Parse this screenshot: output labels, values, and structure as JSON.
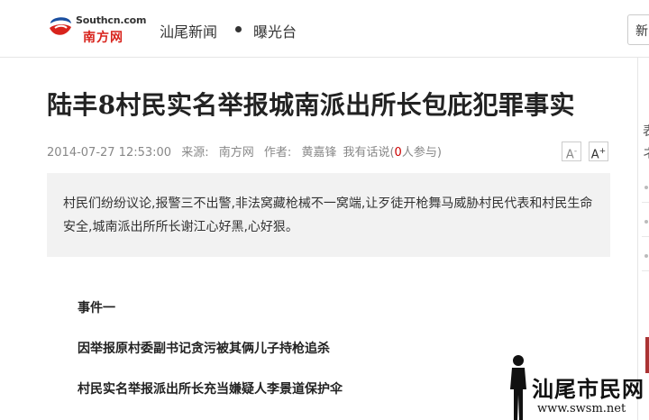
{
  "header": {
    "logo_en": "Southcn.com",
    "logo_cn": "南方网",
    "channel": "汕尾新闻",
    "subchannel": "曝光台",
    "search_text": "新闻",
    "colors": {
      "brand_red": "#d8231c",
      "brand_blue": "#1a4fa0"
    }
  },
  "article": {
    "title": "陆丰8村民实名举报城南派出所长包庇犯罪事实",
    "meta": {
      "datetime": "2014-07-27 12:53:00",
      "source_label": "来源:",
      "source": "南方网",
      "author_label": "作者:",
      "author": "黄嘉锋",
      "comment_label": "我有话说(",
      "comment_count": "0",
      "comment_suffix": "人参与)"
    },
    "font_smaller": "A",
    "font_larger": "A",
    "summary": "村民们纷纷议论,报警三不出警,非法窝藏枪械不一窝端,让歹徒开枪舞马威胁村民代表和村民生命安全,城南派出所所长谢江心好黑,心好狠。",
    "paragraphs": [
      "事件一",
      "因举报原村委副书记贪污被其俩儿子持枪追杀",
      "村民实名举报派出所长充当嫌疑人李景道保护伞"
    ]
  },
  "sidebar": {
    "chars": [
      "表",
      "ネ"
    ]
  },
  "watermark": {
    "text": "汕尾市民网",
    "url": "www.swsm.net"
  }
}
